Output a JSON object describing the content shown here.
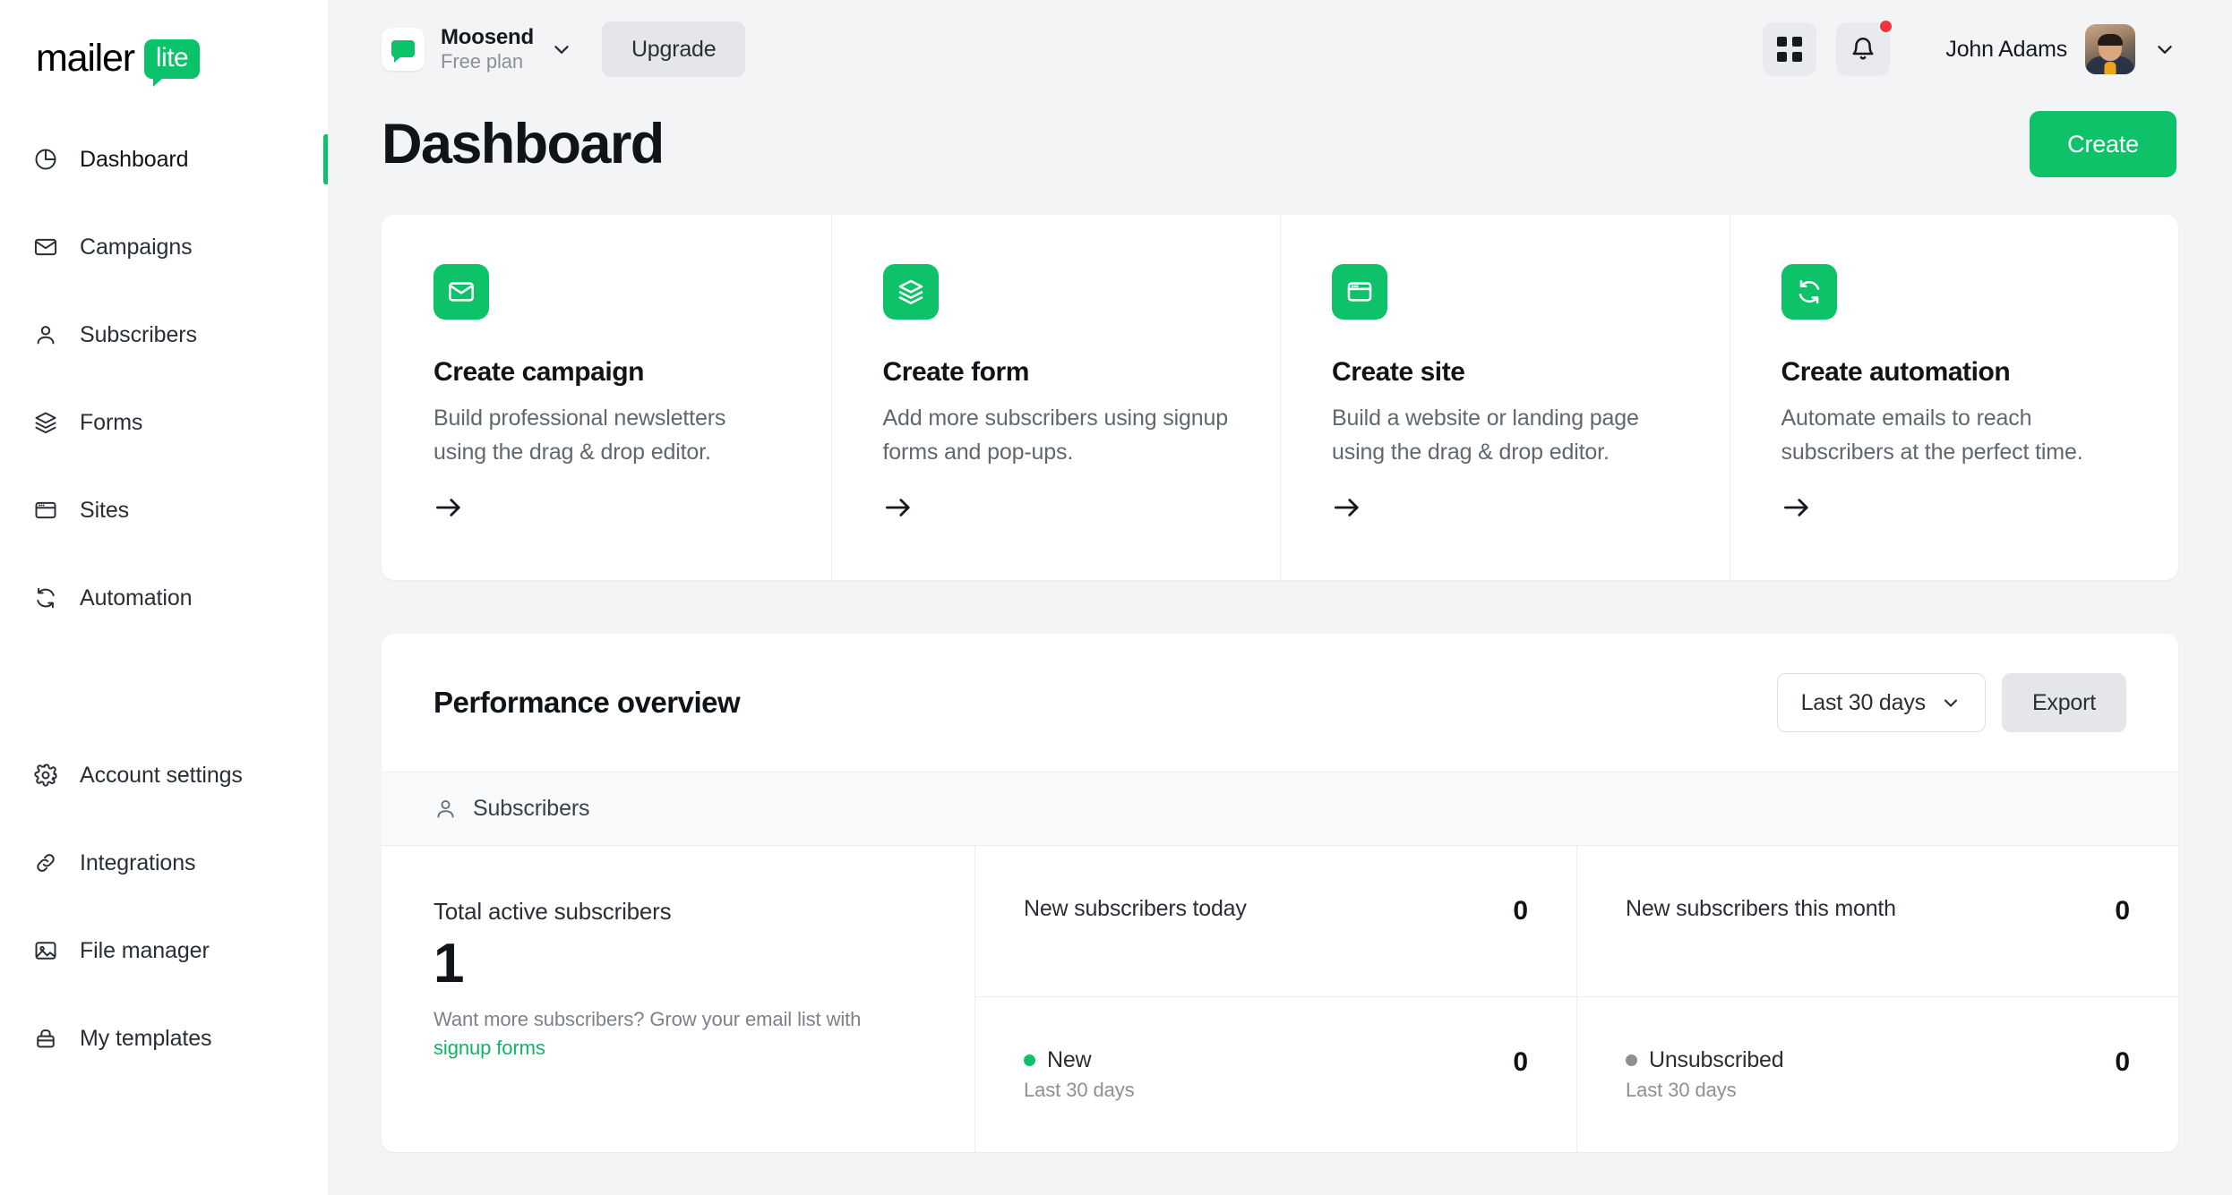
{
  "brand": {
    "logo_text": "mailer",
    "logo_badge": "lite",
    "green": "#0dc268",
    "link_green": "#12b265",
    "notification_red": "#f5333f"
  },
  "sidebar": {
    "primary_items": [
      {
        "label": "Dashboard",
        "icon": "pie-chart-icon",
        "active": true
      },
      {
        "label": "Campaigns",
        "icon": "envelope-icon",
        "active": false
      },
      {
        "label": "Subscribers",
        "icon": "person-icon",
        "active": false
      },
      {
        "label": "Forms",
        "icon": "layers-icon",
        "active": false
      },
      {
        "label": "Sites",
        "icon": "browser-window-icon",
        "active": false
      },
      {
        "label": "Automation",
        "icon": "refresh-icon",
        "active": false
      }
    ],
    "secondary_items": [
      {
        "label": "Account settings",
        "icon": "gear-icon"
      },
      {
        "label": "Integrations",
        "icon": "link-icon"
      },
      {
        "label": "File manager",
        "icon": "image-icon"
      },
      {
        "label": "My templates",
        "icon": "briefcase-icon"
      }
    ]
  },
  "topbar": {
    "account_name": "Moosend",
    "account_plan": "Free plan",
    "upgrade_label": "Upgrade",
    "user_name": "John Adams",
    "has_notification": true
  },
  "page": {
    "title": "Dashboard",
    "create_label": "Create"
  },
  "cards": [
    {
      "icon": "envelope-icon",
      "title": "Create campaign",
      "desc": "Build professional newsletters using the drag & drop editor."
    },
    {
      "icon": "layers-icon",
      "title": "Create form",
      "desc": "Add more subscribers using signup forms and pop-ups."
    },
    {
      "icon": "browser-window-icon",
      "title": "Create site",
      "desc": "Build a website or landing page using the drag & drop editor."
    },
    {
      "icon": "refresh-icon",
      "title": "Create automation",
      "desc": "Automate emails to reach subscribers at the perfect time."
    }
  ],
  "performance": {
    "title": "Performance overview",
    "range_label": "Last 30 days",
    "export_label": "Export",
    "section_label": "Subscribers",
    "total": {
      "label": "Total active subscribers",
      "value": "1",
      "note_prefix": "Want more subscribers? Grow your email list with ",
      "note_link": "signup forms"
    },
    "cells": [
      {
        "label": "New subscribers today",
        "value": "0",
        "sub": "",
        "dot": ""
      },
      {
        "label": "New subscribers this month",
        "value": "0",
        "sub": "",
        "dot": ""
      },
      {
        "label": "New",
        "value": "0",
        "sub": "Last 30 days",
        "dot": "#0dc268"
      },
      {
        "label": "Unsubscribed",
        "value": "0",
        "sub": "Last 30 days",
        "dot": "#8c9096"
      }
    ]
  }
}
